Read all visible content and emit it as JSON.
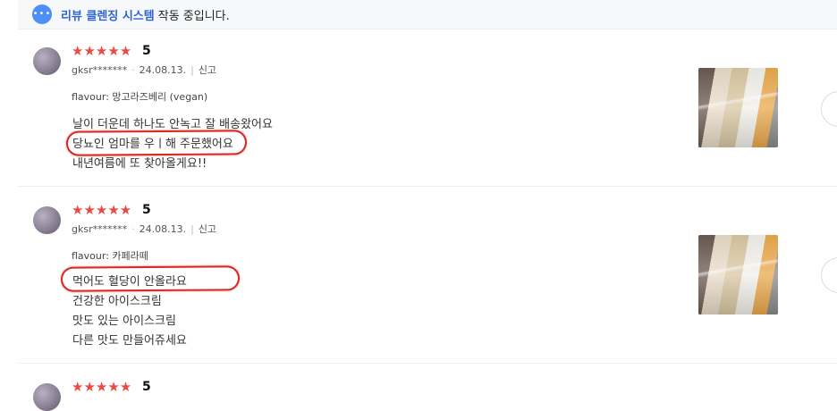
{
  "banner": {
    "icon": "chat-bubble-icon",
    "icon_glyph": "•••",
    "system_name": "리뷰 클렌징 시스템",
    "status_text": "작동 중입니다."
  },
  "colors": {
    "star": "#e94a43",
    "highlight": "#d9281f",
    "link": "#2f64d8"
  },
  "reviews": [
    {
      "stars": "★★★★★",
      "score": "5",
      "author": "gksr*******",
      "date": "24.08.13.",
      "report": "신고",
      "option": "flavour: 망고라즈베리 (vegan)",
      "lines": [
        "날이 더운데 하나도 안녹고 잘 배송왔어요",
        "당뇨인 엄마를 우ㅣ해 주문했어요",
        "내년여름에 또 찾아올게요!!"
      ]
    },
    {
      "stars": "★★★★★",
      "score": "5",
      "author": "gksr*******",
      "date": "24.08.13.",
      "report": "신고",
      "option": "flavour: 카페라떼",
      "lines": [
        "먹어도 혈당이 안올라요",
        "건강한 아이스크림",
        "맛도 있는 아이스크림",
        "다른 맛도 만들어쥬세요"
      ]
    },
    {
      "stars": "★★★★★",
      "score": "5"
    }
  ]
}
